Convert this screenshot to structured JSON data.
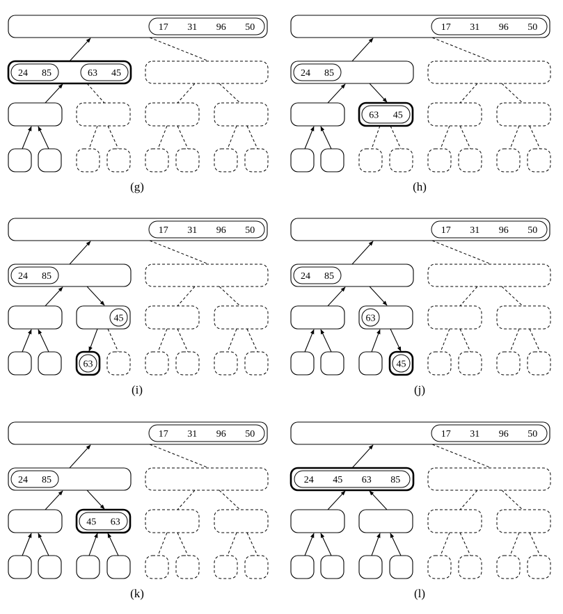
{
  "figure": {
    "panels": [
      {
        "caption": "(g)",
        "nodes": {
          "root": {
            "state": "normal",
            "items": [
              [
                "17",
                "31",
                "96",
                "50"
              ]
            ]
          },
          "L": {
            "state": "bold",
            "items": [
              [
                "24",
                "85"
              ],
              [
                "63",
                "45"
              ]
            ]
          },
          "R": {
            "state": "dashed",
            "items": []
          },
          "LL": {
            "state": "normal",
            "items": []
          },
          "LR": {
            "state": "dashed",
            "items": []
          },
          "RL": {
            "state": "dashed",
            "items": []
          },
          "RR": {
            "state": "dashed",
            "items": []
          },
          "LLL": {
            "state": "normal",
            "items": []
          },
          "LLR": {
            "state": "normal",
            "items": []
          },
          "LRL": {
            "state": "dashed",
            "items": []
          },
          "LRR": {
            "state": "dashed",
            "items": []
          },
          "RLL": {
            "state": "dashed",
            "items": []
          },
          "RLR": {
            "state": "dashed",
            "items": []
          },
          "RRL": {
            "state": "dashed",
            "items": []
          },
          "RRR": {
            "state": "dashed",
            "items": []
          }
        },
        "edges": {
          "root-L": "up",
          "root-R": "dashed",
          "L-LL": "up",
          "L-LR": "dashed",
          "R-RL": "dashed",
          "R-RR": "dashed",
          "LL-LLL": "up",
          "LL-LLR": "up",
          "LR-LRL": "dashed",
          "LR-LRR": "dashed",
          "RL-RLL": "dashed",
          "RL-RLR": "dashed",
          "RR-RRL": "dashed",
          "RR-RRR": "dashed"
        }
      },
      {
        "caption": "(h)",
        "nodes": {
          "root": {
            "state": "normal",
            "items": [
              [
                "17",
                "31",
                "96",
                "50"
              ]
            ]
          },
          "L": {
            "state": "normal",
            "items": [
              [
                "24",
                "85"
              ]
            ]
          },
          "R": {
            "state": "dashed",
            "items": []
          },
          "LL": {
            "state": "normal",
            "items": []
          },
          "LR": {
            "state": "bold",
            "items": [
              [
                "63",
                "45"
              ]
            ]
          },
          "RL": {
            "state": "dashed",
            "items": []
          },
          "RR": {
            "state": "dashed",
            "items": []
          },
          "LLL": {
            "state": "normal",
            "items": []
          },
          "LLR": {
            "state": "normal",
            "items": []
          },
          "LRL": {
            "state": "dashed",
            "items": []
          },
          "LRR": {
            "state": "dashed",
            "items": []
          },
          "RLL": {
            "state": "dashed",
            "items": []
          },
          "RLR": {
            "state": "dashed",
            "items": []
          },
          "RRL": {
            "state": "dashed",
            "items": []
          },
          "RRR": {
            "state": "dashed",
            "items": []
          }
        },
        "edges": {
          "root-L": "up",
          "root-R": "dashed",
          "L-LL": "up",
          "L-LR": "down",
          "R-RL": "dashed",
          "R-RR": "dashed",
          "LL-LLL": "up",
          "LL-LLR": "up",
          "LR-LRL": "dashed",
          "LR-LRR": "dashed",
          "RL-RLL": "dashed",
          "RL-RLR": "dashed",
          "RR-RRL": "dashed",
          "RR-RRR": "dashed"
        }
      },
      {
        "caption": "(i)",
        "nodes": {
          "root": {
            "state": "normal",
            "items": [
              [
                "17",
                "31",
                "96",
                "50"
              ]
            ]
          },
          "L": {
            "state": "normal",
            "items": [
              [
                "24",
                "85"
              ]
            ]
          },
          "R": {
            "state": "dashed",
            "items": []
          },
          "LL": {
            "state": "normal",
            "items": []
          },
          "LR": {
            "state": "normal",
            "items": [
              [
                "45"
              ]
            ],
            "align": "right"
          },
          "RL": {
            "state": "dashed",
            "items": []
          },
          "RR": {
            "state": "dashed",
            "items": []
          },
          "LLL": {
            "state": "normal",
            "items": []
          },
          "LLR": {
            "state": "normal",
            "items": []
          },
          "LRL": {
            "state": "bold",
            "items": [
              [
                "63"
              ]
            ]
          },
          "LRR": {
            "state": "dashed",
            "items": []
          },
          "RLL": {
            "state": "dashed",
            "items": []
          },
          "RLR": {
            "state": "dashed",
            "items": []
          },
          "RRL": {
            "state": "dashed",
            "items": []
          },
          "RRR": {
            "state": "dashed",
            "items": []
          }
        },
        "edges": {
          "root-L": "up",
          "root-R": "dashed",
          "L-LL": "up",
          "L-LR": "down",
          "R-RL": "dashed",
          "R-RR": "dashed",
          "LL-LLL": "up",
          "LL-LLR": "up",
          "LR-LRL": "down",
          "LR-LRR": "dashed",
          "RL-RLL": "dashed",
          "RL-RLR": "dashed",
          "RR-RRL": "dashed",
          "RR-RRR": "dashed"
        }
      },
      {
        "caption": "(j)",
        "nodes": {
          "root": {
            "state": "normal",
            "items": [
              [
                "17",
                "31",
                "96",
                "50"
              ]
            ]
          },
          "L": {
            "state": "normal",
            "items": [
              [
                "24",
                "85"
              ]
            ]
          },
          "R": {
            "state": "dashed",
            "items": []
          },
          "LL": {
            "state": "normal",
            "items": []
          },
          "LR": {
            "state": "normal",
            "items": [
              [
                "63"
              ]
            ]
          },
          "RL": {
            "state": "dashed",
            "items": []
          },
          "RR": {
            "state": "dashed",
            "items": []
          },
          "LLL": {
            "state": "normal",
            "items": []
          },
          "LLR": {
            "state": "normal",
            "items": []
          },
          "LRL": {
            "state": "normal",
            "items": []
          },
          "LRR": {
            "state": "bold",
            "items": [
              [
                "45"
              ]
            ]
          },
          "RLL": {
            "state": "dashed",
            "items": []
          },
          "RLR": {
            "state": "dashed",
            "items": []
          },
          "RRL": {
            "state": "dashed",
            "items": []
          },
          "RRR": {
            "state": "dashed",
            "items": []
          }
        },
        "edges": {
          "root-L": "up",
          "root-R": "dashed",
          "L-LL": "up",
          "L-LR": "down",
          "R-RL": "dashed",
          "R-RR": "dashed",
          "LL-LLL": "up",
          "LL-LLR": "up",
          "LR-LRL": "up",
          "LR-LRR": "down",
          "RL-RLL": "dashed",
          "RL-RLR": "dashed",
          "RR-RRL": "dashed",
          "RR-RRR": "dashed"
        }
      },
      {
        "caption": "(k)",
        "nodes": {
          "root": {
            "state": "normal",
            "items": [
              [
                "17",
                "31",
                "96",
                "50"
              ]
            ]
          },
          "L": {
            "state": "normal",
            "items": [
              [
                "24",
                "85"
              ]
            ]
          },
          "R": {
            "state": "dashed",
            "items": []
          },
          "LL": {
            "state": "normal",
            "items": []
          },
          "LR": {
            "state": "bold",
            "items": [
              [
                "45",
                "63"
              ]
            ]
          },
          "RL": {
            "state": "dashed",
            "items": []
          },
          "RR": {
            "state": "dashed",
            "items": []
          },
          "LLL": {
            "state": "normal",
            "items": []
          },
          "LLR": {
            "state": "normal",
            "items": []
          },
          "LRL": {
            "state": "normal",
            "items": []
          },
          "LRR": {
            "state": "normal",
            "items": []
          },
          "RLL": {
            "state": "dashed",
            "items": []
          },
          "RLR": {
            "state": "dashed",
            "items": []
          },
          "RRL": {
            "state": "dashed",
            "items": []
          },
          "RRR": {
            "state": "dashed",
            "items": []
          }
        },
        "edges": {
          "root-L": "up",
          "root-R": "dashed",
          "L-LL": "up",
          "L-LR": "down",
          "R-RL": "dashed",
          "R-RR": "dashed",
          "LL-LLL": "up",
          "LL-LLR": "up",
          "LR-LRL": "up",
          "LR-LRR": "up",
          "RL-RLL": "dashed",
          "RL-RLR": "dashed",
          "RR-RRL": "dashed",
          "RR-RRR": "dashed"
        }
      },
      {
        "caption": "(l)",
        "nodes": {
          "root": {
            "state": "normal",
            "items": [
              [
                "17",
                "31",
                "96",
                "50"
              ]
            ]
          },
          "L": {
            "state": "bold",
            "items": [
              [
                "24",
                "45",
                "63",
                "85"
              ]
            ],
            "fullWidth": true
          },
          "R": {
            "state": "dashed",
            "items": []
          },
          "LL": {
            "state": "normal",
            "items": []
          },
          "LR": {
            "state": "normal",
            "items": []
          },
          "RL": {
            "state": "dashed",
            "items": []
          },
          "RR": {
            "state": "dashed",
            "items": []
          },
          "LLL": {
            "state": "normal",
            "items": []
          },
          "LLR": {
            "state": "normal",
            "items": []
          },
          "LRL": {
            "state": "normal",
            "items": []
          },
          "LRR": {
            "state": "normal",
            "items": []
          },
          "RLL": {
            "state": "dashed",
            "items": []
          },
          "RLR": {
            "state": "dashed",
            "items": []
          },
          "RRL": {
            "state": "dashed",
            "items": []
          },
          "RRR": {
            "state": "dashed",
            "items": []
          }
        },
        "edges": {
          "root-L": "up",
          "root-R": "dashed",
          "L-LL": "up",
          "L-LR": "up",
          "R-RL": "dashed",
          "R-RR": "dashed",
          "LL-LLL": "up",
          "LL-LLR": "up",
          "LR-LRL": "up",
          "LR-LRR": "up",
          "RL-RLL": "dashed",
          "RL-RLR": "dashed",
          "RR-RRL": "dashed",
          "RR-RRR": "dashed"
        }
      }
    ]
  }
}
